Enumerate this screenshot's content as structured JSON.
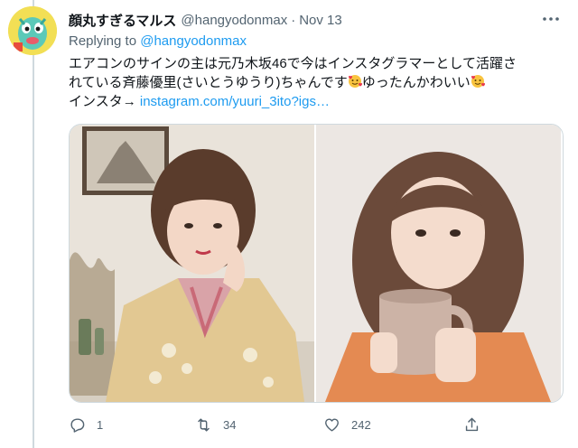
{
  "tweet": {
    "display_name": "顔丸すぎるマルス",
    "handle": "@hangyodonmax",
    "separator": "·",
    "time": "Nov 13",
    "replying_prefix": "Replying to",
    "replying_to": "@hangyodonmax",
    "text_line1": "エアコンのサインの主は元乃木坂46で今はインスタグラマーとして活躍さ",
    "text_line2a": "れている斉藤優里(さいとうゆうり)ちゃんです",
    "text_line2b": "ゆったんかわいい",
    "text_line3_prefix": "インスタ→ ",
    "link_text": "instagram.com/yuuri_3ito?igs…"
  },
  "actions": {
    "reply_count": "1",
    "retweet_count": "34",
    "like_count": "242"
  },
  "icons": {
    "avatar": "hangyodon-avatar",
    "more": "more-dots-icon",
    "emoji": "smiling-face-with-hearts-emoji",
    "reply": "reply-icon",
    "retweet": "retweet-icon",
    "like": "heart-icon",
    "share": "share-icon"
  },
  "colors": {
    "link": "#1d9bf0",
    "secondary_text": "#536471",
    "primary_text": "#0f1419"
  }
}
